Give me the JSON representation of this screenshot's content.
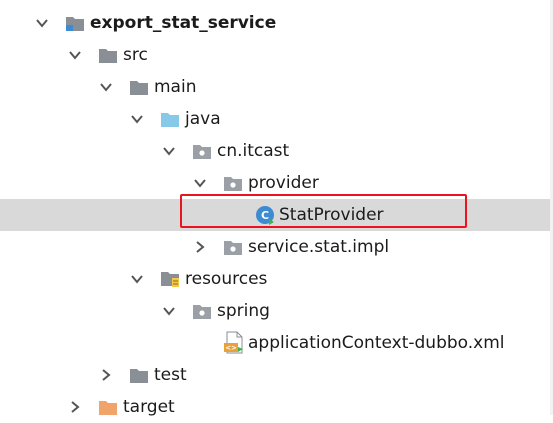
{
  "tree": {
    "rows": [
      {
        "label": "export_stat_service",
        "bold": true
      },
      {
        "label": "src"
      },
      {
        "label": "main"
      },
      {
        "label": "java"
      },
      {
        "label": "cn.itcast"
      },
      {
        "label": "provider"
      },
      {
        "label": "StatProvider",
        "selected": true
      },
      {
        "label": "service.stat.impl"
      },
      {
        "label": "resources"
      },
      {
        "label": "spring"
      },
      {
        "label": "applicationContext-dubbo.xml"
      },
      {
        "label": "test"
      },
      {
        "label": "target"
      }
    ]
  },
  "colors": {
    "selection_bg": "#d9d9d9",
    "highlight_border": "#e8141e",
    "java_folder": "#87c9e8",
    "module_folder": "#8a8f96",
    "package_folder": "#9aa0a6",
    "target_folder": "#f0a46a",
    "class_icon": "#3d8bd1"
  }
}
